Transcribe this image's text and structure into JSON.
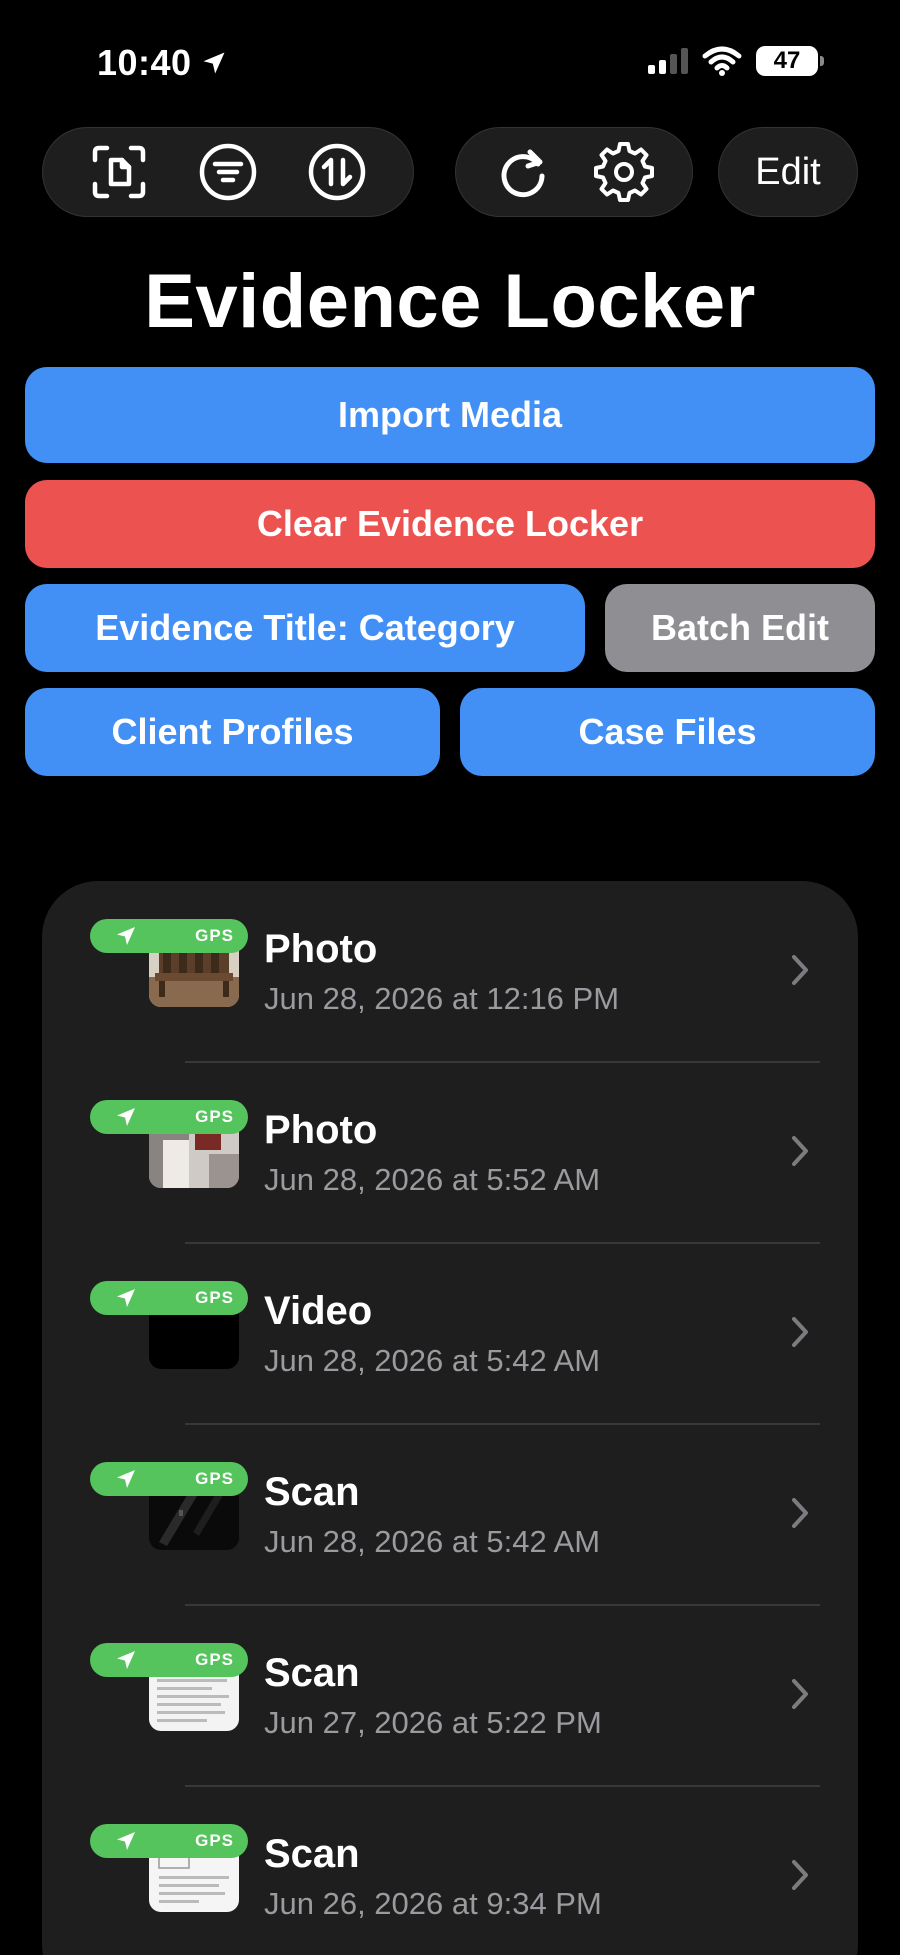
{
  "status_bar": {
    "time": "10:40",
    "battery": "47"
  },
  "toolbar": {
    "left_icons": [
      "document-scan-icon",
      "filter-icon",
      "sort-icon"
    ],
    "mid_icons": [
      "refresh-icon",
      "gear-icon"
    ],
    "edit_label": "Edit"
  },
  "page_title": "Evidence Locker",
  "buttons": {
    "import_media": "Import Media",
    "clear_locker": "Clear Evidence Locker",
    "evidence_title": "Evidence Title: Category",
    "batch_edit": "Batch Edit",
    "client_profiles": "Client Profiles",
    "case_files": "Case Files"
  },
  "colors": {
    "blue": "#4290f6",
    "red": "#ec5250",
    "gray": "#8e8e93",
    "gps_green": "#55c45d"
  },
  "gps_label": "GPS",
  "items": [
    {
      "title": "Photo",
      "date": "Jun 28, 2026 at 12:16 PM",
      "thumb": "bench"
    },
    {
      "title": "Photo",
      "date": "Jun 28, 2026 at 5:52 AM",
      "thumb": "room"
    },
    {
      "title": "Video",
      "date": "Jun 28, 2026 at 5:42 AM",
      "thumb": "dark"
    },
    {
      "title": "Scan",
      "date": "Jun 28, 2026 at 5:42 AM",
      "thumb": "dark-scan"
    },
    {
      "title": "Scan",
      "date": "Jun 27, 2026 at 5:22 PM",
      "thumb": "paper"
    },
    {
      "title": "Scan",
      "date": "Jun 26, 2026 at 9:34 PM",
      "thumb": "paper2"
    }
  ]
}
